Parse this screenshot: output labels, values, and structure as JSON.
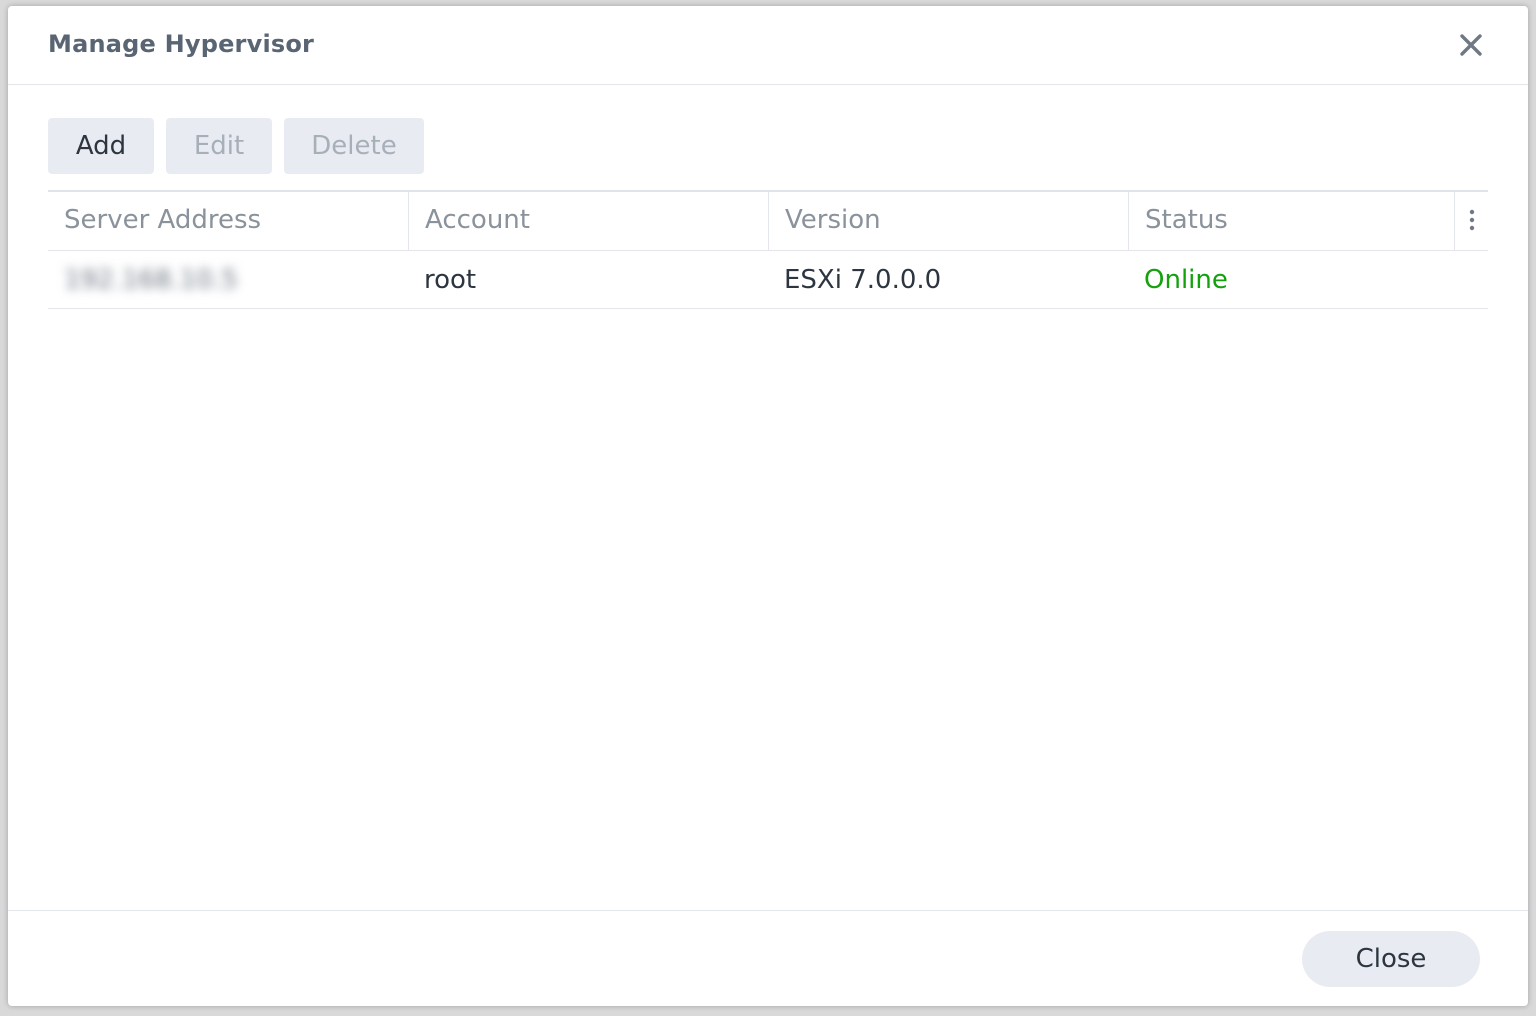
{
  "dialog": {
    "title": "Manage Hypervisor",
    "close_icon": "close-icon"
  },
  "toolbar": {
    "add_label": "Add",
    "edit_label": "Edit",
    "delete_label": "Delete"
  },
  "table": {
    "columns": [
      "Server Address",
      "Account",
      "Version",
      "Status"
    ],
    "column_menu_icon": "more-vertical-icon",
    "rows": [
      {
        "server_address": "192.168.10.5",
        "account": "root",
        "version": "ESXi 7.0.0.0",
        "status": "Online"
      }
    ]
  },
  "footer": {
    "close_label": "Close"
  },
  "colors": {
    "status_online": "#13a10e",
    "button_bg": "#e8ecf2",
    "title_text": "#5a6573"
  }
}
